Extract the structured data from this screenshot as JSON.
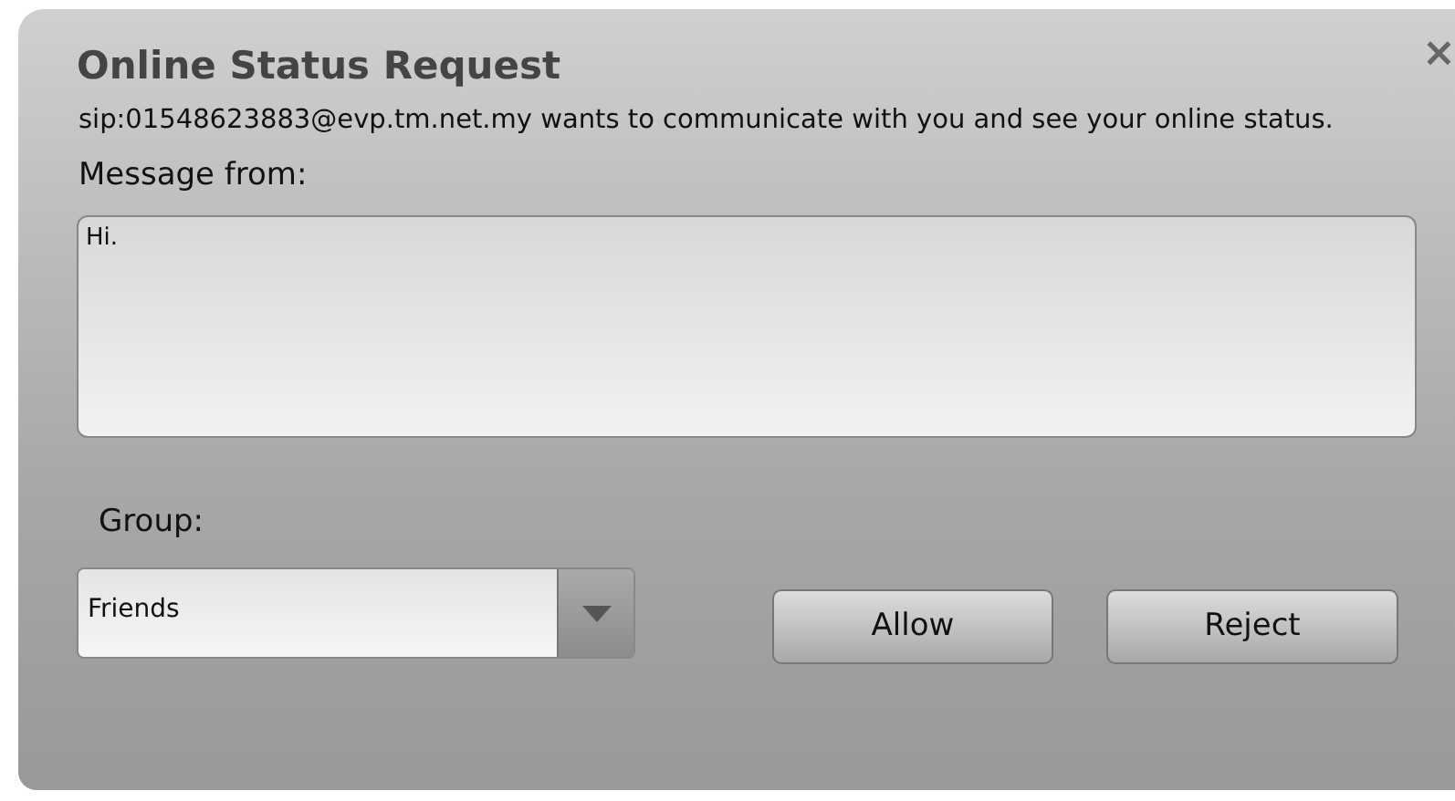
{
  "dialog": {
    "title": "Online Status Request",
    "close": "×",
    "description": "sip:01548623883@evp.tm.net.my wants to communicate with you and see your online status.",
    "message_label": "Message from:",
    "message": "Hi.",
    "group_label": "Group:",
    "group": "Friends",
    "buttons": [
      "Allow",
      "Reject"
    ]
  }
}
